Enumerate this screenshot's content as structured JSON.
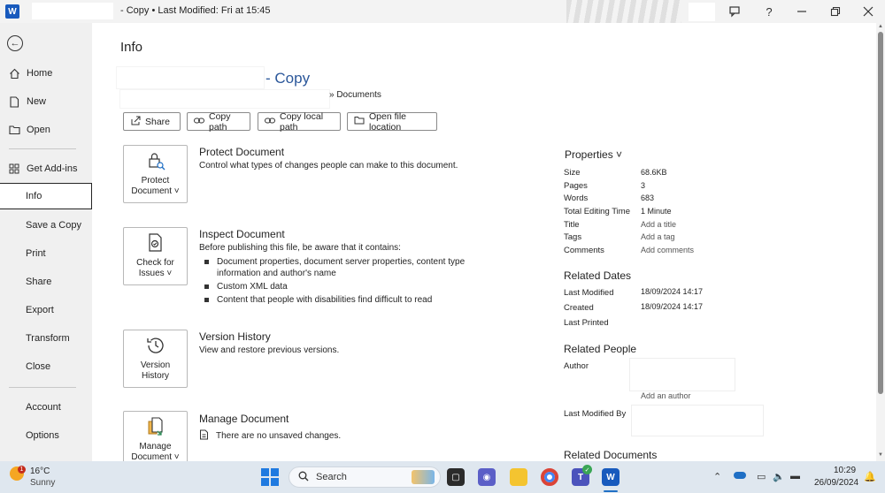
{
  "window": {
    "app_icon": "word-icon",
    "title_suffix": "- Copy  •  Last Modified: Fri at 15:45",
    "logo_letter": "W"
  },
  "nav": {
    "items": [
      {
        "label": "Home",
        "icon": "home-icon"
      },
      {
        "label": "New",
        "icon": "new-doc-icon"
      },
      {
        "label": "Open",
        "icon": "folder-icon"
      },
      {
        "label": "Get Add-ins",
        "icon": "addins-icon"
      },
      {
        "label": "Info",
        "active": true
      },
      {
        "label": "Save a Copy"
      },
      {
        "label": "Print"
      },
      {
        "label": "Share"
      },
      {
        "label": "Export"
      },
      {
        "label": "Transform"
      },
      {
        "label": "Close"
      },
      {
        "label": "Account"
      },
      {
        "label": "Options"
      }
    ]
  },
  "info": {
    "title": "Info",
    "doc_name": "- Copy",
    "path": "» Documents",
    "buttons": {
      "share": "Share",
      "copy_path": "Copy path",
      "copy_local_path": "Copy local path",
      "open_file_location": "Open file location"
    },
    "protect": {
      "button_line1": "Protect",
      "button_line2": "Document ˅",
      "title": "Protect Document",
      "desc": "Control what types of changes people can make to this document."
    },
    "inspect": {
      "button_line1": "Check for",
      "button_line2": "Issues ˅",
      "title": "Inspect Document",
      "desc": "Before publishing this file, be aware that it contains:",
      "bullets": [
        "Document properties, document server properties, content type information and author's name",
        "Custom XML data",
        "Content that people with disabilities find difficult to read"
      ]
    },
    "version": {
      "button_line1": "Version",
      "button_line2": "History",
      "title": "Version History",
      "desc": "View and restore previous versions."
    },
    "manage": {
      "button_line1": "Manage",
      "button_line2": "Document ˅",
      "title": "Manage Document",
      "desc": "There are no unsaved changes."
    }
  },
  "properties": {
    "heading": "Properties ˅",
    "rows": [
      {
        "label": "Size",
        "value": "68.6KB"
      },
      {
        "label": "Pages",
        "value": "3"
      },
      {
        "label": "Words",
        "value": "683"
      },
      {
        "label": "Total Editing Time",
        "value": "1 Minute"
      },
      {
        "label": "Title",
        "value": "Add a title"
      },
      {
        "label": "Tags",
        "value": "Add a tag"
      },
      {
        "label": "Comments",
        "value": "Add comments"
      }
    ],
    "related_dates": {
      "heading": "Related Dates",
      "rows": [
        {
          "label": "Last Modified",
          "value": "18/09/2024 14:17"
        },
        {
          "label": "Created",
          "value": "18/09/2024 14:17"
        },
        {
          "label": "Last Printed",
          "value": ""
        }
      ]
    },
    "related_people": {
      "heading": "Related People",
      "author_label": "Author",
      "add_author": "Add an author",
      "last_modified_by": "Last Modified By"
    },
    "related_documents": "Related Documents"
  },
  "taskbar": {
    "weather_temp": "16°C",
    "weather_desc": "Sunny",
    "weather_badge": "1",
    "search_label": "Search",
    "time": "10:29",
    "date": "26/09/2024"
  }
}
